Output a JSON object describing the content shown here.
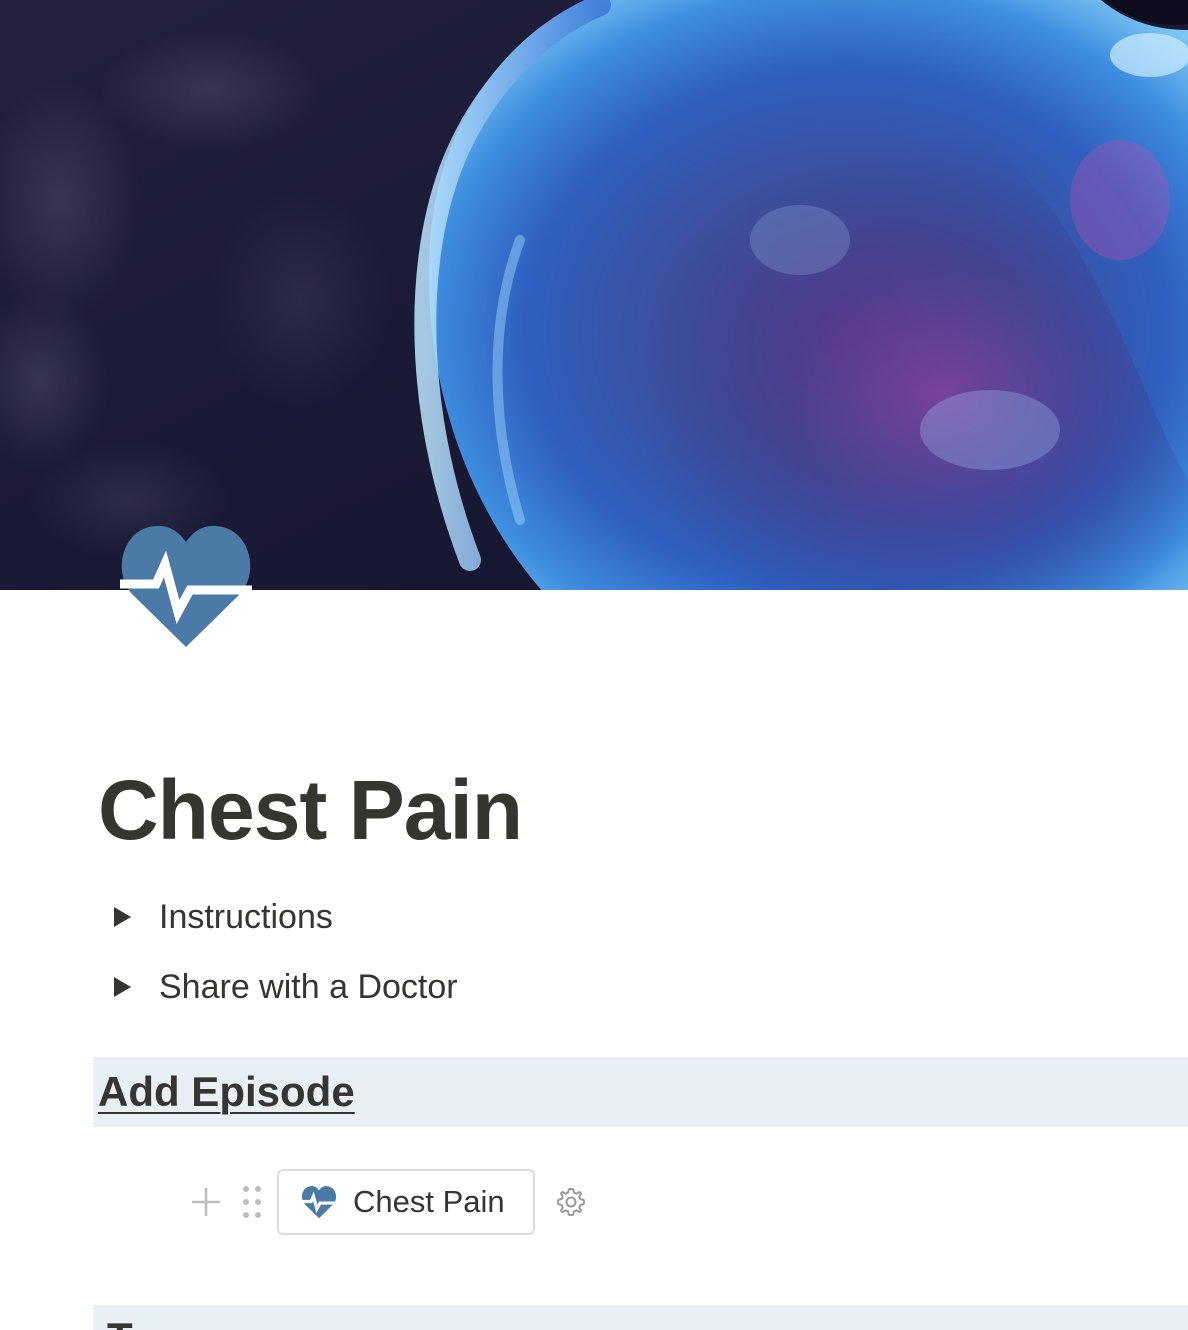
{
  "cover": {
    "image": "blue-glass-heart-photo"
  },
  "page_icon": {
    "icon": "heartbeat-icon",
    "color": "#4a7aa5"
  },
  "page": {
    "title": "Chest Pain"
  },
  "toggles": [
    {
      "label": "Instructions",
      "icon": "triangle-right-icon",
      "expanded": false
    },
    {
      "label": "Share with a Doctor",
      "icon": "triangle-right-icon",
      "expanded": false
    }
  ],
  "sections": [
    {
      "heading": "Add Episode",
      "link": true
    },
    {
      "heading": "T"
    }
  ],
  "template_button": {
    "label": "Chest Pain",
    "icon": "heartbeat-icon",
    "settings_icon": "gear-icon"
  },
  "colors": {
    "text": "#37352f",
    "heading_band": "#e8f0f6",
    "icon_blue": "#4a7aa5",
    "handle_gray": "#bdbdb9"
  }
}
